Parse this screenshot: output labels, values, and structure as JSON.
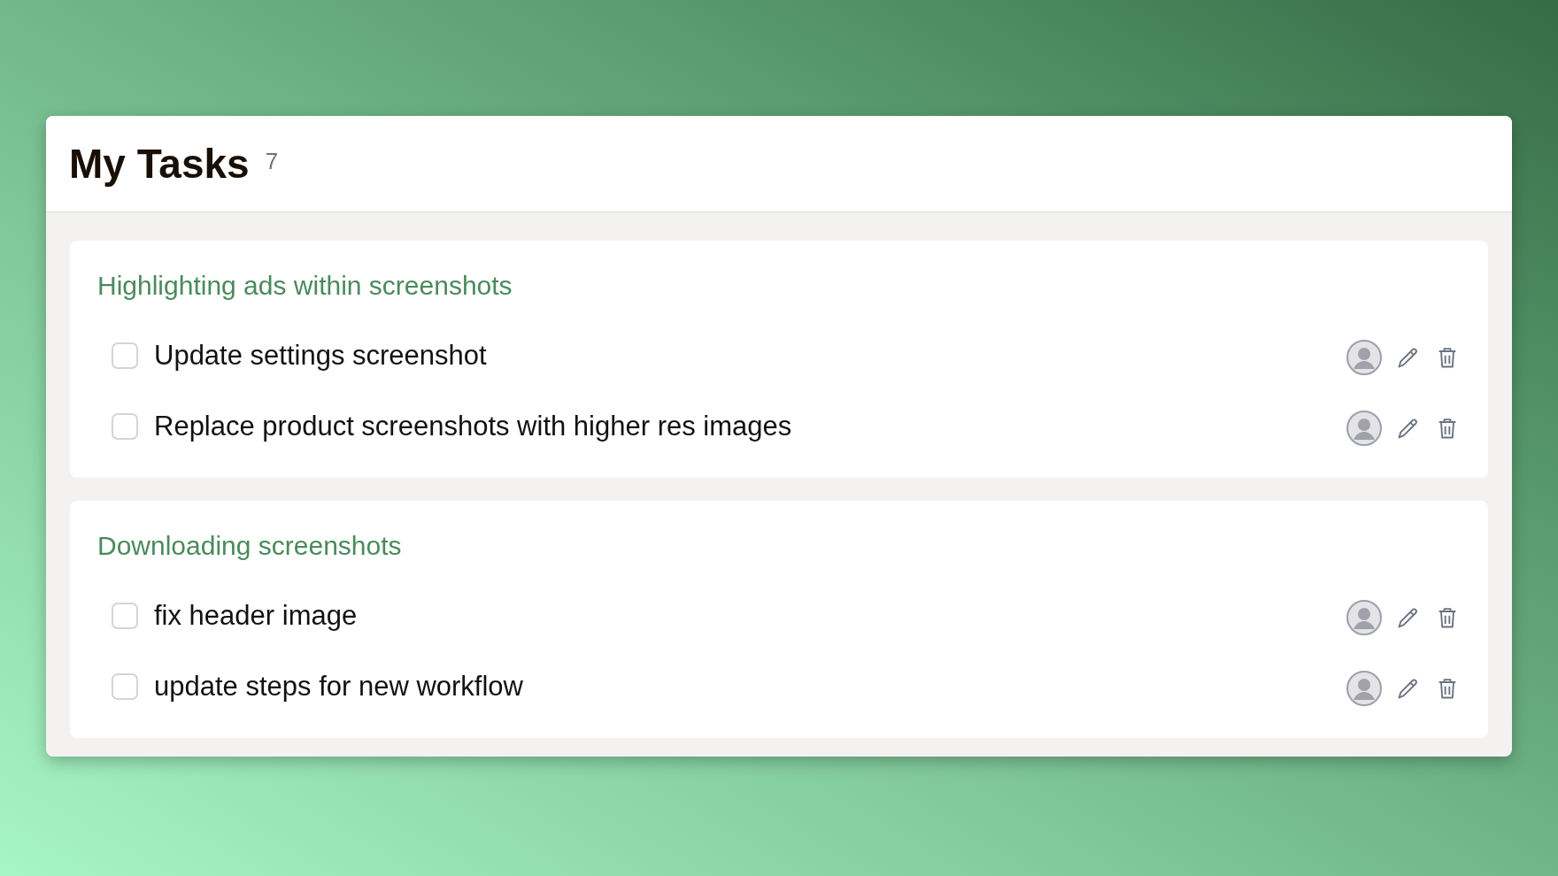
{
  "header": {
    "title": "My Tasks",
    "count": "7"
  },
  "groups": [
    {
      "title": "Highlighting ads within screenshots",
      "tasks": [
        {
          "label": "Update settings screenshot",
          "checked": false
        },
        {
          "label": "Replace product screenshots with higher res images",
          "checked": false
        }
      ]
    },
    {
      "title": "Downloading screenshots",
      "tasks": [
        {
          "label": "fix header image",
          "checked": false
        },
        {
          "label": "update steps for new workflow",
          "checked": false
        }
      ]
    }
  ]
}
